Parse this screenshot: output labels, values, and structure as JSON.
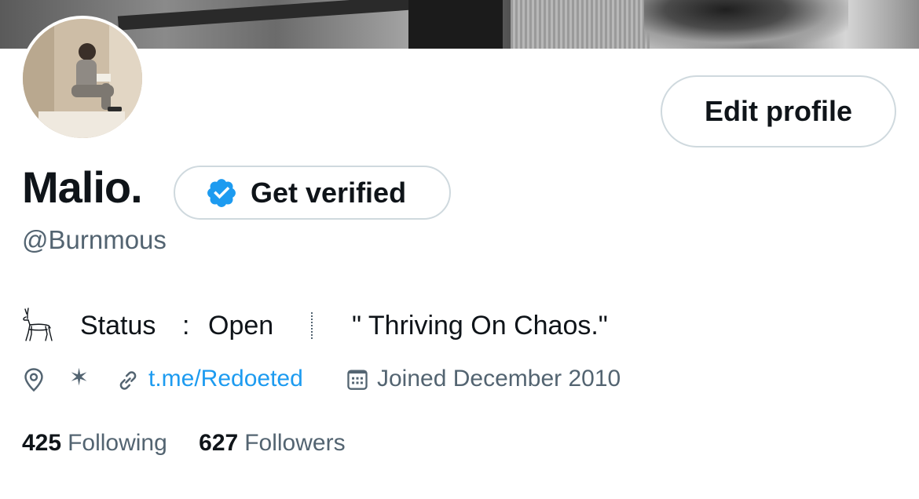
{
  "profile": {
    "display_name": "Malio.",
    "handle": "@Burnmous",
    "edit_profile_label": "Edit profile",
    "get_verified_label": "Get verified"
  },
  "bio": {
    "icon": "deer-icon",
    "status_label": "Status",
    "colon": ":",
    "status_value": "Open",
    "quote": "\" Thriving On Chaos.\""
  },
  "meta": {
    "location_icon": "location-pin-icon",
    "location_text": "✶",
    "link_icon": "link-icon",
    "link_text": "t.me/Redoeted",
    "calendar_icon": "calendar-icon",
    "joined_text": "Joined December 2010"
  },
  "stats": {
    "following_count": "425",
    "following_label": "Following",
    "followers_count": "627",
    "followers_label": "Followers"
  },
  "colors": {
    "text_primary": "#0f1419",
    "text_secondary": "#536471",
    "link": "#1d9bf0",
    "verified_badge": "#1d9bf0",
    "button_border": "#cfd9de"
  }
}
